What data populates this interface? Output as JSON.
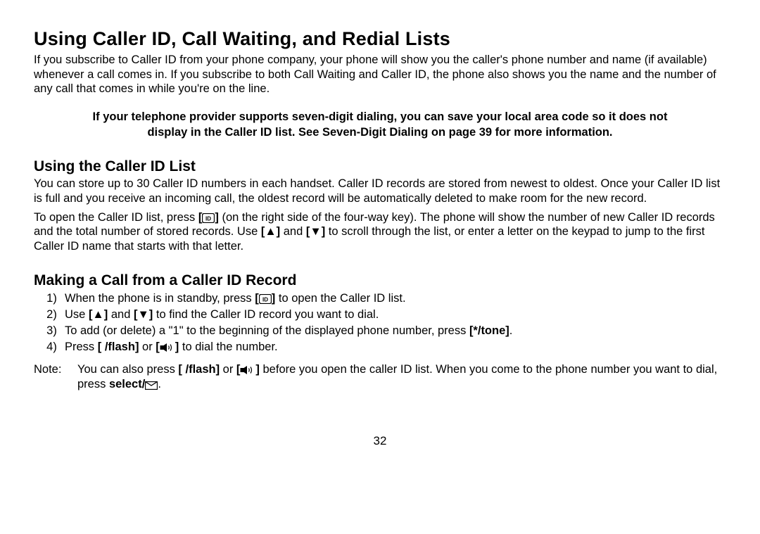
{
  "h1": "Using Caller ID, Call Waiting, and Redial Lists",
  "intro": "If you subscribe to Caller ID from your phone company, your phone will show you the caller's phone number and name (if available) whenever a call comes in. If you subscribe to both Call Waiting and Caller ID, the phone also shows you the name and the number of any call that comes in while you're on the line.",
  "callout": "If your telephone provider supports seven-digit dialing, you can save your local area code so it does not display in the Caller ID list. See Seven-Digit Dialing on page 39 for more information.",
  "h2a": "Using the Caller ID List",
  "p_a1": "You can store up to 30 Caller ID numbers in each handset. Caller ID records are stored from newest to oldest. Once your Caller ID list is full and you receive an incoming call, the oldest record will be automatically deleted to make room for the new record.",
  "p_a2_part1": "To open the Caller ID list, press ",
  "p_a2_part2": " (on the right side of the four-way key). The phone will show the number of new Caller ID records and the total number of stored records. Use ",
  "p_a2_part3": " and ",
  "p_a2_part4": "  to scroll through the list, or enter a letter on the keypad to jump to the first Caller ID name that starts with that letter.",
  "h2b": "Making a Call from a Caller ID Record",
  "li1_a": "When the phone is in standby, press ",
  "li1_b": " to open the Caller ID list.",
  "li2_a": "Use ",
  "li2_b": " and ",
  "li2_c": " to find the Caller ID record you want to dial.",
  "li3_a": "To add (or delete) a \"1\" to the beginning of the displayed phone number, press ",
  "li3_b": "[*/tone]",
  "li3_c": ".",
  "li4_a": "Press ",
  "li4_b": "[ /flash]",
  "li4_c": " or ",
  "li4_d": " to dial the number.",
  "note_label": "Note:",
  "note_a": "You can also press ",
  "note_flash": "[ /flash]",
  "note_b": " or ",
  "note_c": " before you open the caller ID list. When you come to the phone number you want to dial, press ",
  "note_select": "select/",
  "note_d": ".",
  "key_up": "[▲]",
  "key_down": "[▼]",
  "page": "32"
}
